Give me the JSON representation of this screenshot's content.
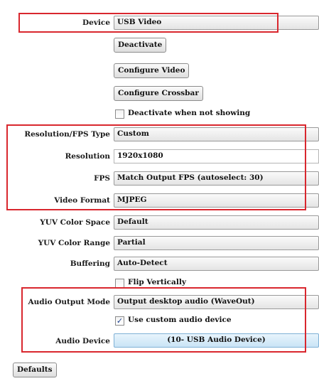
{
  "device": {
    "label": "Device",
    "value": "USB Video"
  },
  "buttons": {
    "deactivate": "Deactivate",
    "configure_video": "Configure Video",
    "configure_crossbar": "Configure Crossbar",
    "defaults": "Defaults"
  },
  "deactivate_not_showing": {
    "label": "Deactivate when not showing",
    "checked": false
  },
  "resolution_fps_type": {
    "label": "Resolution/FPS Type",
    "value": "Custom"
  },
  "resolution": {
    "label": "Resolution",
    "value": "1920x1080"
  },
  "fps": {
    "label": "FPS",
    "value": "Match Output FPS (autoselect: 30)"
  },
  "video_format": {
    "label": "Video Format",
    "value": "MJPEG"
  },
  "yuv_color_space": {
    "label": "YUV Color Space",
    "value": "Default"
  },
  "yuv_color_range": {
    "label": "YUV Color Range",
    "value": "Partial"
  },
  "buffering": {
    "label": "Buffering",
    "value": "Auto-Detect"
  },
  "flip_vertically": {
    "label": "Flip Vertically",
    "checked": false
  },
  "audio_output_mode": {
    "label": "Audio Output Mode",
    "value": "Output desktop audio (WaveOut)"
  },
  "use_custom_audio": {
    "label": "Use custom audio device",
    "checked": true,
    "check_glyph": "✓"
  },
  "audio_device": {
    "label": "Audio Device",
    "value": "(10- USB Audio Device)"
  },
  "colors": {
    "highlight_box": "#d9272e",
    "selected_combo": "#c9e4f6"
  }
}
